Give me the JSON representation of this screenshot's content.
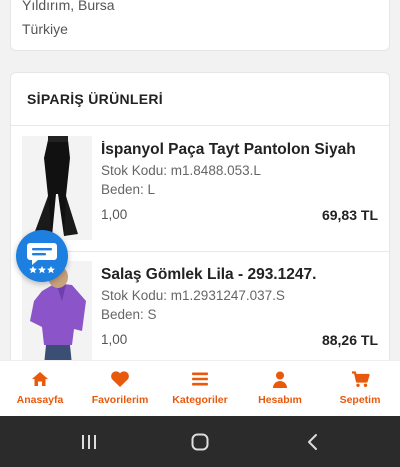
{
  "address": {
    "line1": "Yıldırım, Bursa",
    "line2": "Türkiye"
  },
  "orders": {
    "title": "SİPARİŞ ÜRÜNLERİ",
    "items": [
      {
        "name": "İspanyol Paça Tayt Pantolon Siyah",
        "stock_code": "Stok Kodu: m1.8488.053.L",
        "size": "Beden: L",
        "quantity": "1,00",
        "price": "69,83 TL"
      },
      {
        "name": "Salaş Gömlek Lila - 293.1247.",
        "stock_code": "Stok Kodu: m1.2931247.037.S",
        "size": "Beden: S",
        "quantity": "1,00",
        "price": "88,26 TL"
      }
    ]
  },
  "nav": {
    "items": [
      {
        "label": "Anasayfa",
        "icon": "home-icon"
      },
      {
        "label": "Favorilerim",
        "icon": "heart-icon"
      },
      {
        "label": "Kategoriler",
        "icon": "menu-icon"
      },
      {
        "label": "Hesabım",
        "icon": "user-icon"
      },
      {
        "label": "Sepetim",
        "icon": "cart-icon"
      }
    ]
  },
  "colors": {
    "accent": "#e8590c",
    "chat_button": "#1d7fe0",
    "system_bar": "#2b2b2b"
  }
}
